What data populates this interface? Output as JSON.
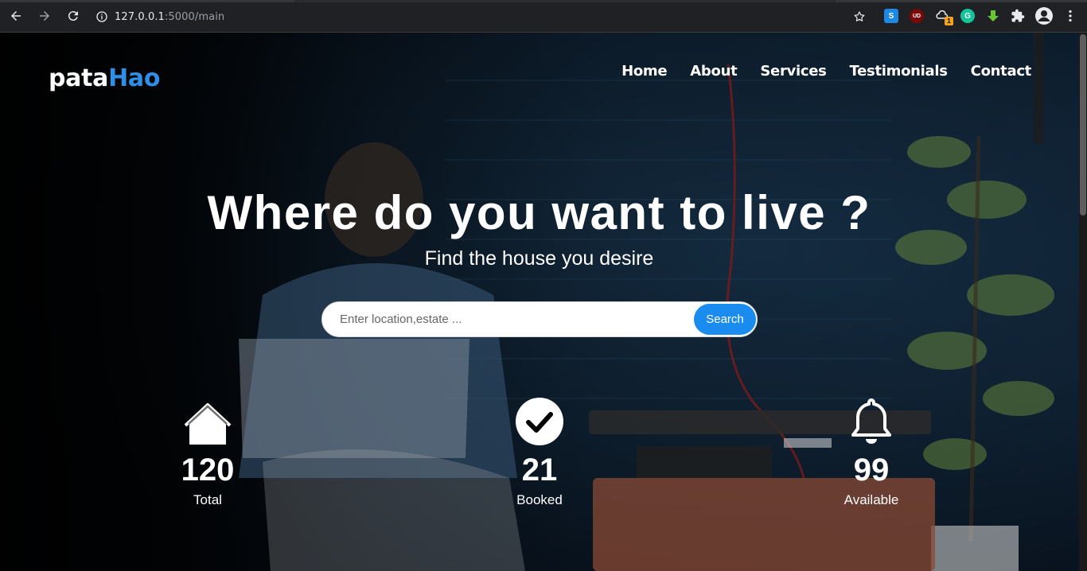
{
  "browser": {
    "url_host": "127.0.0.1",
    "url_path": ":5000/main",
    "extensions": [
      "s-extension-icon",
      "ublock-icon",
      "weather-extension-icon",
      "grammarly-icon",
      "download-extension-icon",
      "puzzle-icon"
    ],
    "badge": "1"
  },
  "brand": {
    "part1": "pata",
    "part2": "Hao",
    "accent_color": "#2e8fe8"
  },
  "nav": {
    "items": [
      {
        "label": "Home"
      },
      {
        "label": "About"
      },
      {
        "label": "Services"
      },
      {
        "label": "Testimonials"
      },
      {
        "label": "Contact"
      }
    ]
  },
  "hero": {
    "title": "Where do you want to live ?",
    "subtitle": "Find the house you desire"
  },
  "search": {
    "placeholder": "Enter location,estate ...",
    "value": "",
    "button_label": "Search",
    "button_color": "#1a8cf0"
  },
  "stats": [
    {
      "icon": "house-icon",
      "value": "120",
      "label": "Total"
    },
    {
      "icon": "check-circle-icon",
      "value": "21",
      "label": "Booked"
    },
    {
      "icon": "bell-icon",
      "value": "99",
      "label": "Available"
    }
  ]
}
